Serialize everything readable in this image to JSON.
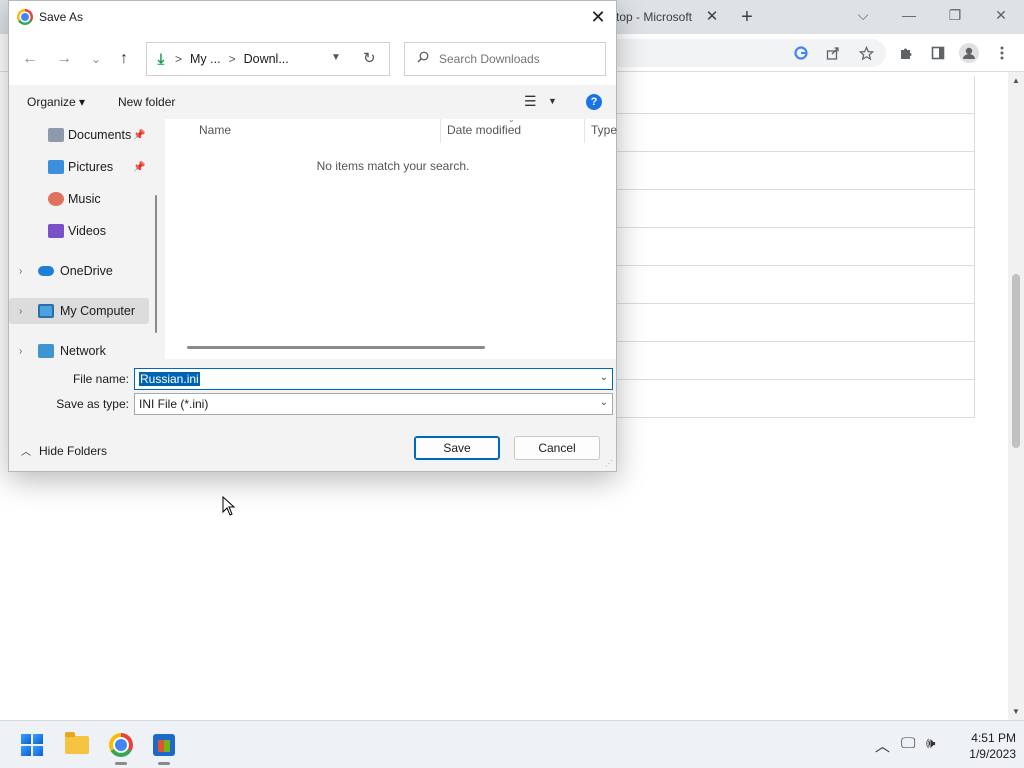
{
  "browser": {
    "tab_title": "top - Microsoft",
    "tab_close": "✕",
    "new_tab": "+",
    "window_controls": {
      "tabsearch": "⌵",
      "minimize": "—",
      "restore": "❐",
      "close": "✕"
    },
    "toolbar_icons": [
      "google-icon",
      "share-icon",
      "star-icon",
      "extensions-icon",
      "sidepanel-icon",
      "profile-icon",
      "menu-icon"
    ]
  },
  "dialog": {
    "title": "Save As",
    "close": "✕",
    "nav": {
      "back": "←",
      "forward": "→",
      "recent": "⌄",
      "up": "↑"
    },
    "address": {
      "crumbs": [
        "My ...",
        "Downl..."
      ],
      "separator": ">"
    },
    "search": {
      "placeholder": "Search Downloads"
    },
    "commands": {
      "organize": "Organize ▾",
      "new_folder": "New folder"
    },
    "sidebar": {
      "items": [
        {
          "label": "Documents",
          "pinned": true
        },
        {
          "label": "Pictures",
          "pinned": true
        },
        {
          "label": "Music"
        },
        {
          "label": "Videos"
        },
        {
          "label": "OneDrive",
          "expandable": true
        },
        {
          "label": "My Computer",
          "expandable": true,
          "selected": true
        },
        {
          "label": "Network",
          "expandable": true
        }
      ]
    },
    "columns": [
      "Name",
      "Date modified",
      "Type"
    ],
    "empty_message": "No items match your search.",
    "file_name_label": "File name:",
    "file_name_value": "Russian.ini",
    "save_type_label": "Save as type:",
    "save_type_value": "INI File (*.ini)",
    "hide_folders": "Hide Folders",
    "save_button": "Save",
    "cancel_button": "Cancel",
    "help": "?"
  },
  "taskbar": {
    "time": "4:51 PM",
    "date": "1/9/2023",
    "apps": [
      "start-button",
      "file-explorer",
      "chrome",
      "microsoft-store"
    ]
  },
  "colors": {
    "accent": "#0067c0",
    "selection": "#0063b1",
    "dialog_bg": "#f3f3f3"
  }
}
